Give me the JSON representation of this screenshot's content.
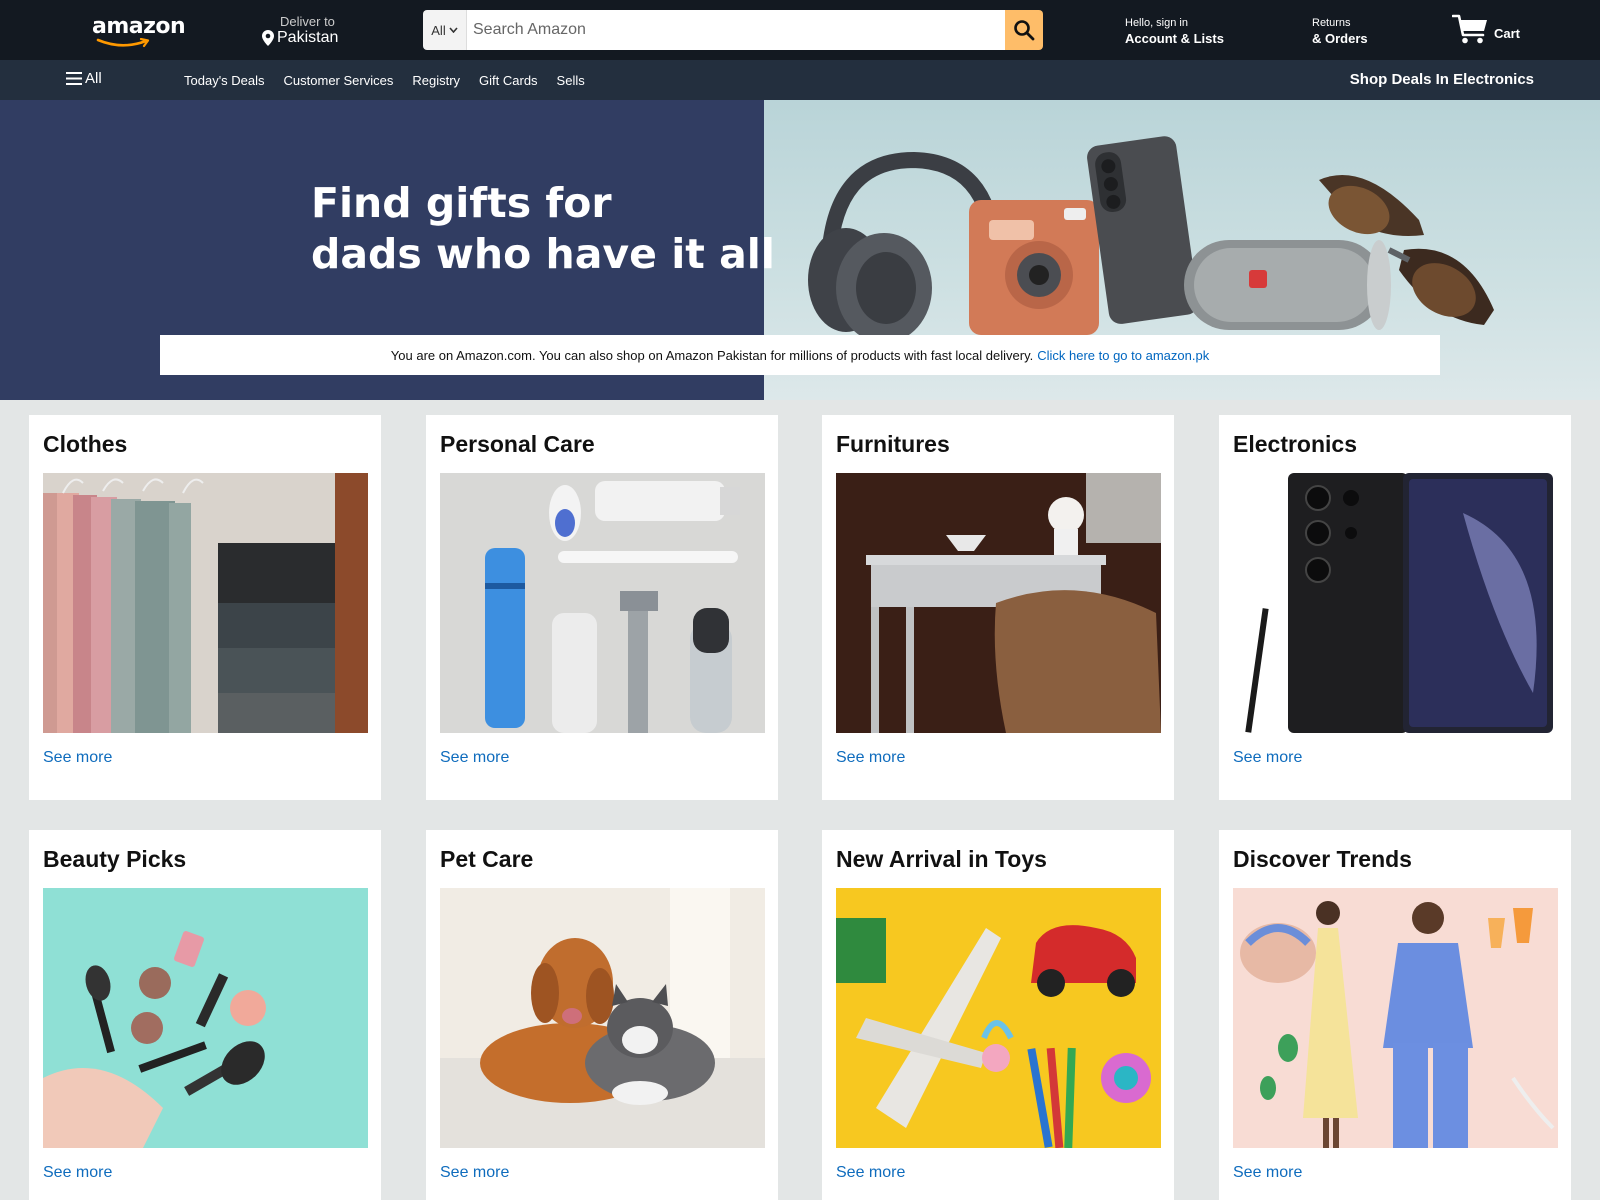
{
  "header": {
    "logo_text": "amazon",
    "deliver_label": "Deliver to",
    "deliver_country": "Pakistan",
    "search_category": "All",
    "search_placeholder": "Search Amazon",
    "account_line1": "Hello, sign in",
    "account_line2": "Account & Lists",
    "orders_line1": "Returns",
    "orders_line2": "& Orders",
    "cart_label": "Cart"
  },
  "subnav": {
    "all_label": "All",
    "links": [
      "Today's Deals",
      "Customer Services",
      "Registry",
      "Gift Cards",
      "Sells"
    ],
    "deals_label": "Shop Deals In Electronics"
  },
  "hero": {
    "title_line1": "Find gifts for",
    "title_line2": "dads who have it all",
    "notice_text": "You are on Amazon.com. You can also shop on Amazon Pakistan for millions of products with fast local delivery.",
    "notice_link": "Click here to go to amazon.pk"
  },
  "cards": [
    {
      "title": "Clothes",
      "link": "See more"
    },
    {
      "title": "Personal Care",
      "link": "See more"
    },
    {
      "title": "Furnitures",
      "link": "See more"
    },
    {
      "title": "Electronics",
      "link": "See more"
    },
    {
      "title": "Beauty Picks",
      "link": "See more"
    },
    {
      "title": "Pet Care",
      "link": "See more"
    },
    {
      "title": "New Arrival in Toys",
      "link": "See more"
    },
    {
      "title": "Discover Trends",
      "link": "See more"
    }
  ],
  "colors": {
    "nav_bg": "#131921",
    "subnav_bg": "#232f3e",
    "search_button": "#febd69",
    "hero_left": "#313d62",
    "link": "#0f6cbd"
  },
  "icons": [
    "pin-icon",
    "dropdown-caret-icon",
    "search-icon",
    "cart-icon",
    "hamburger-icon"
  ]
}
